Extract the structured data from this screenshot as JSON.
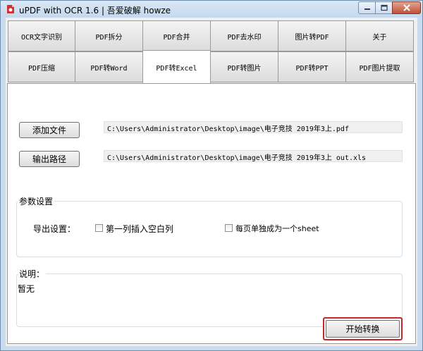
{
  "window": {
    "title": "uPDF with OCR 1.6 | 吾爱破解 howze"
  },
  "tabs_row1": [
    "OCR文字识别",
    "PDF拆分",
    "PDF合并",
    "PDF去水印",
    "图片转PDF",
    "关于"
  ],
  "tabs_row2": [
    "PDF压缩",
    "PDF转Word",
    "PDF转Excel",
    "PDF转图片",
    "PDF转PPT",
    "PDF图片提取"
  ],
  "active_tab": "PDF转Excel",
  "files": {
    "add_button": "添加文件",
    "input_path": "C:\\Users\\Administrator\\Desktop\\image\\电子竞技 2019年3上.pdf",
    "output_button": "输出路径",
    "output_path": "C:\\Users\\Administrator\\Desktop\\image\\电子竞技 2019年3上_out.xls"
  },
  "settings": {
    "group_label": "参数设置",
    "export_label": "导出设置：",
    "option1": "第一列插入空白列",
    "option1_checked": false,
    "option2": "每页单独成为一个sheet",
    "option2_checked": false
  },
  "notes": {
    "group_label": "说明：",
    "content": "暂无"
  },
  "actions": {
    "start_button": "开始转换"
  },
  "icons": {
    "app": "pdf-app-icon",
    "minimize": "minimize-icon",
    "maximize": "maximize-icon",
    "close": "close-icon"
  },
  "colors": {
    "focus_border": "#c62828",
    "app_icon": "#d32f2f"
  }
}
